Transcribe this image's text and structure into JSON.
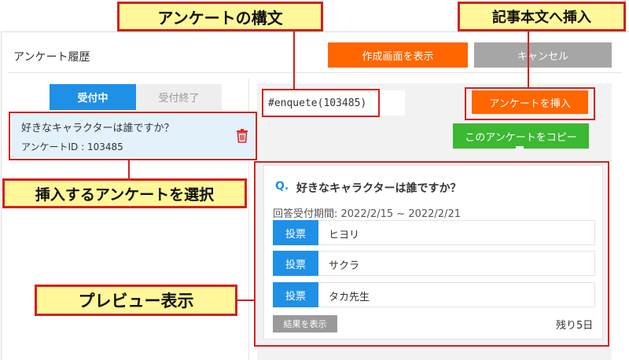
{
  "page_title": "アンケート履歴",
  "buttons": {
    "create": "作成画面を表示",
    "cancel": "キャンセル",
    "insert": "アンケートを挿入",
    "copy": "このアンケートをコピー",
    "results": "結果を表示"
  },
  "tabs": {
    "open": "受付中",
    "closed": "受付終了"
  },
  "survey_item": {
    "title": "好きなキャラクターは誰ですか？",
    "id_label": "アンケートID : 103485"
  },
  "syntax": "#enquete(103485)",
  "preview": {
    "q_mark": "Q.",
    "question": "好きなキャラクターは誰ですか？",
    "period": "回答受付期間: 2022/2/15 ~ 2022/2/21",
    "vote_label": "投票",
    "options": [
      "ヒヨリ",
      "サクラ",
      "タカ先生"
    ],
    "remaining": "残り5日"
  },
  "callouts": {
    "syntax": "アンケートの構文",
    "body": "記事本文へ挿入",
    "select": "挿入するアンケートを選択",
    "preview": "プレビュー表示"
  },
  "colors": {
    "orange": "#ff6600",
    "blue": "#1e90e6",
    "green": "#3cb832",
    "highlight": "#d41f1f",
    "callout_bg": "#fff799"
  },
  "icons": {
    "trash": "trash-icon"
  }
}
